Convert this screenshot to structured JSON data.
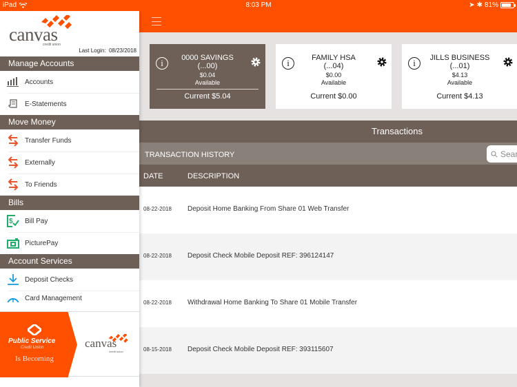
{
  "status_bar": {
    "device": "iPad",
    "time": "8:03 PM",
    "battery": "81%",
    "battery_level": 0.81
  },
  "sidebar": {
    "brand": "canvas",
    "brand_sub": "credit union",
    "last_login_label": "Last Login:",
    "last_login_date": "08/23/2018",
    "sections": [
      {
        "title": "Manage Accounts",
        "items": [
          {
            "label": "Accounts",
            "icon": "bar-chart-icon"
          },
          {
            "label": "E-Statements",
            "icon": "statement-icon"
          }
        ]
      },
      {
        "title": "Move Money",
        "items": [
          {
            "label": "Transfer Funds",
            "icon": "transfer-arrows-icon"
          },
          {
            "label": "Externally",
            "icon": "transfer-arrows-icon"
          },
          {
            "label": "To Friends",
            "icon": "transfer-arrows-icon"
          }
        ]
      },
      {
        "title": "Bills",
        "items": [
          {
            "label": "Bill Pay",
            "icon": "bill-pay-icon"
          },
          {
            "label": "PicturePay",
            "icon": "camera-icon"
          }
        ]
      },
      {
        "title": "Account Services",
        "items": [
          {
            "label": "Deposit Checks",
            "icon": "download-icon"
          },
          {
            "label": "Card Management",
            "icon": "card-icon"
          }
        ]
      }
    ],
    "banner": {
      "line1": "Public Service",
      "line2": "Credit Union",
      "line3": "Is Becoming",
      "brand": "canvas",
      "brand_sub": "credit union"
    }
  },
  "accounts": [
    {
      "name": "0000 SAVINGS",
      "number": "(...00)",
      "available_amount": "$0.04",
      "available_label": "Available",
      "current": "Current $5.04",
      "active": true
    },
    {
      "name": "FAMILY HSA",
      "number": "(...04)",
      "available_amount": "$0.00",
      "available_label": "Available",
      "current": "Current $0.00",
      "active": false
    },
    {
      "name": "JILLS BUSINESS",
      "number": "(...01)",
      "available_amount": "$4.13",
      "available_label": "Available",
      "current": "Current $4.13",
      "active": false
    }
  ],
  "transactions": {
    "title": "Transactions",
    "history_label": "TRANSACTION HISTORY",
    "search_placeholder": "Search",
    "columns": {
      "date": "DATE",
      "description": "DESCRIPTION"
    },
    "rows": [
      {
        "date": "08-22-2018",
        "description": "Deposit Home Banking From Share 01 Web Transfer"
      },
      {
        "date": "08-22-2018",
        "description": "Deposit Check Mobile Deposit REF: 396124147"
      },
      {
        "date": "08-22-2018",
        "description": "Withdrawal Home Banking To Share 01 Mobile Transfer"
      },
      {
        "date": "08-15-2018",
        "description": "Deposit Check Mobile Deposit REF: 393115607"
      }
    ]
  },
  "colors": {
    "brand_orange": "#ff5000",
    "header_brown": "#6e6057",
    "history_gray": "#8a807a",
    "green_icon": "#1fae6a",
    "blue_icon": "#1a9be0"
  }
}
